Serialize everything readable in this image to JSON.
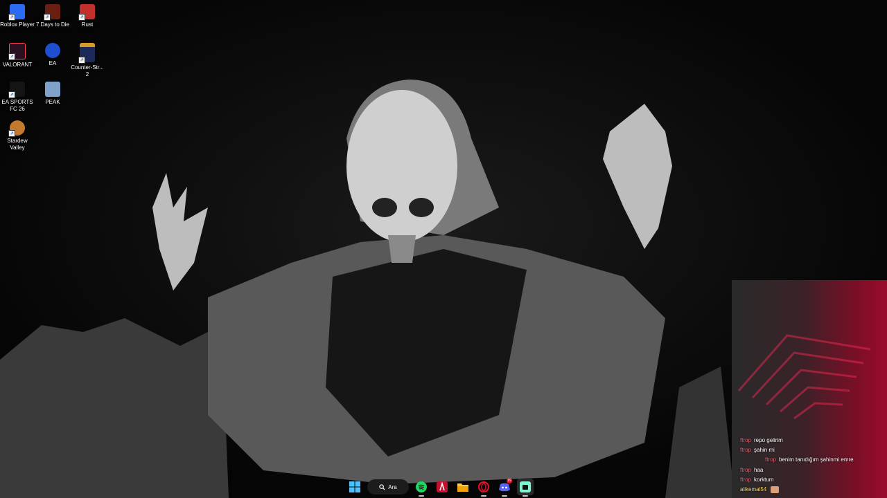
{
  "desktop": {
    "icons": [
      {
        "label": "Roblox Player",
        "color": "#2a6bf2"
      },
      {
        "label": "7 Days to Die",
        "color": "#6b1e12"
      },
      {
        "label": "Rust",
        "color": "#c2302b"
      },
      {
        "label": "VALORANT",
        "color": "#2a1020"
      },
      {
        "label": "EA",
        "color": "#1f4fd1"
      },
      {
        "label": "Counter-Str... 2",
        "color": "#d79a27"
      },
      {
        "label": "EA SPORTS FC 26",
        "color": "#141414"
      },
      {
        "label": "PEAK",
        "color": "#7fa0c9"
      },
      {
        "label": "Stardew Valley",
        "color": "#c47a2e"
      }
    ]
  },
  "taskbar": {
    "search_label": "Ara",
    "discord_badge": "99"
  },
  "chat": {
    "messages": [
      {
        "user": "ftrop",
        "text": "repo gelirim"
      },
      {
        "user": "ftrop",
        "text": "şahin mi"
      },
      {
        "user": "ftrop",
        "text": "benim tanıdığım şahinmi emre"
      },
      {
        "user": "ftrop",
        "text": "haa"
      },
      {
        "user": "ftrop",
        "text": "korktum"
      },
      {
        "user": "alikemal54",
        "text": ""
      }
    ]
  }
}
